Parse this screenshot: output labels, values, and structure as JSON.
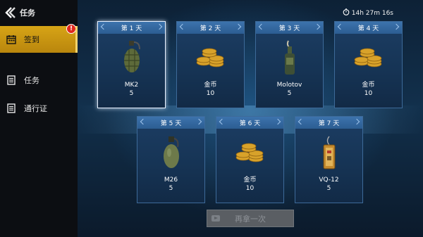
{
  "header": {
    "title": "任务",
    "back_icon": "chevron-left-icon"
  },
  "sidebar": {
    "items": [
      {
        "label": "签到",
        "icon": "calendar-icon",
        "active": true,
        "badge": "!"
      },
      {
        "label": "任务",
        "icon": "list-icon",
        "active": false
      },
      {
        "label": "通行证",
        "icon": "list-icon",
        "active": false
      }
    ]
  },
  "timer": {
    "icon": "stopwatch-icon",
    "text": "14h 27m 16s"
  },
  "days": [
    {
      "day": "第 1 天",
      "name": "MK2",
      "qty": "5",
      "icon": "frag-grenade-icon",
      "selected": true
    },
    {
      "day": "第 2 天",
      "name": "金币",
      "qty": "10",
      "icon": "gold-coins-icon",
      "selected": false
    },
    {
      "day": "第 3 天",
      "name": "Molotov",
      "qty": "5",
      "icon": "molotov-icon",
      "selected": false
    },
    {
      "day": "第 4 天",
      "name": "金币",
      "qty": "10",
      "icon": "gold-coins-icon",
      "selected": false
    },
    {
      "day": "第 5 天",
      "name": "M26",
      "qty": "5",
      "icon": "m26-grenade-icon",
      "selected": false
    },
    {
      "day": "第 6 天",
      "name": "金币",
      "qty": "10",
      "icon": "gold-coins-icon",
      "selected": false
    },
    {
      "day": "第 7 天",
      "name": "VQ-12",
      "qty": "5",
      "icon": "vq12-tag-icon",
      "selected": false
    }
  ],
  "again_button": {
    "label": "再拿一次",
    "icon": "video-play-icon",
    "enabled": false
  },
  "colors": {
    "active_tab": "#d7a416",
    "badge": "#e0271c",
    "card_header": "#3d73ad",
    "button_disabled": "#5a5e63"
  }
}
